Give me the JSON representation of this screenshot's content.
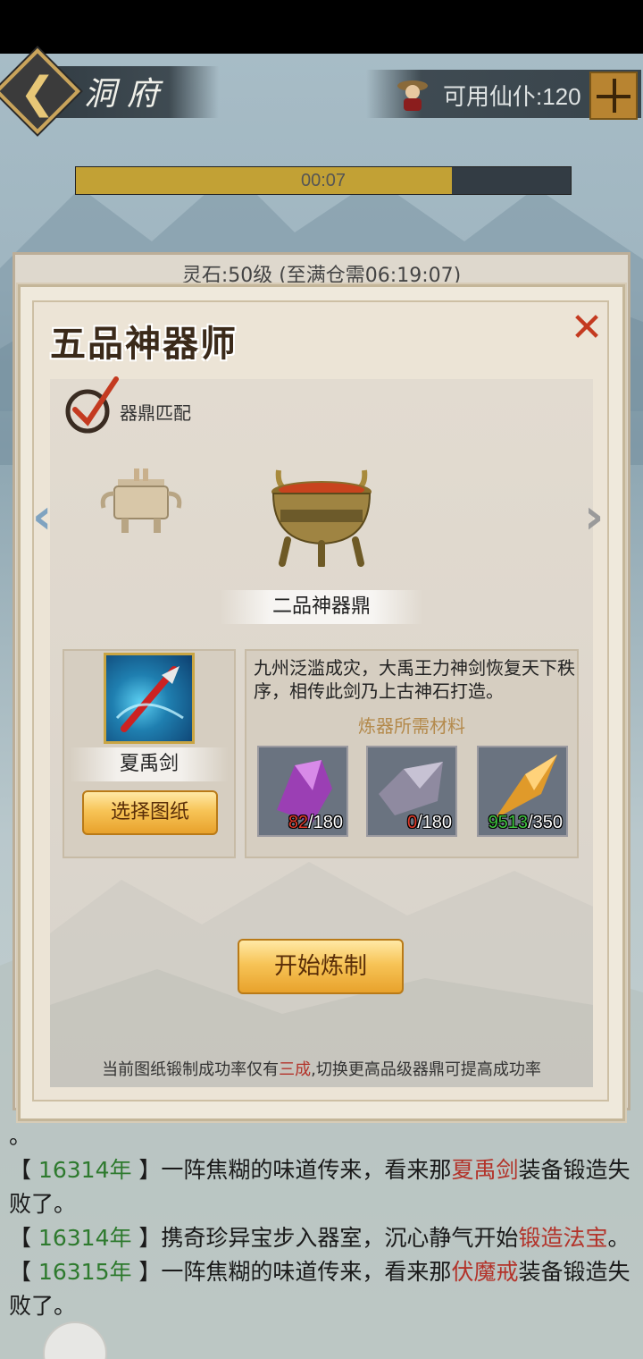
{
  "header": {
    "title": "洞府",
    "servant_label": "可用仙仆:120",
    "plus_label": "+"
  },
  "progress": {
    "time": "00:07",
    "fill_ratio": 0.76
  },
  "back_panel": {
    "title": "灵石:50级 (至满仓需06:19:07)"
  },
  "dialog": {
    "title": "五品神器师",
    "close_icon": "close-icon",
    "match_label": "器鼎匹配",
    "cauldron_name": "二品神器鼎",
    "blueprint": {
      "name": "夏禹剑",
      "select_button": "选择图纸"
    },
    "description": "九州泛滥成灾，大禹王力神剑恢复天下秩序，相传此剑乃上古神石打造。",
    "materials_title": "炼器所需材料",
    "materials": [
      {
        "have": "82",
        "need": "/180",
        "have_color": "#e03a2a",
        "name": "purple-crystal"
      },
      {
        "have": "0",
        "need": "/180",
        "have_color": "#e03a2a",
        "name": "grey-ore"
      },
      {
        "have": "9513",
        "need": "/350",
        "have_color": "#3fc43f",
        "name": "amber-shard"
      }
    ],
    "start_button": "开始炼制",
    "hint_prefix": "当前图纸锻制成功率仅有",
    "hint_rate": "三成",
    "hint_suffix": ",切换更高品级器鼎可提高成功率"
  },
  "log": {
    "lines": [
      {
        "prefix": "。",
        "year": "",
        "mid": "",
        "item": "",
        "suffix": ""
      },
      {
        "prefix": "【 ",
        "year": "16314年",
        "mid": " 】一阵焦糊的味道传来，看来那",
        "item": "夏禹剑",
        "suffix": "装备锻造失败了。"
      },
      {
        "prefix": "【 ",
        "year": "16314年",
        "mid": " 】携奇珍异宝步入器室，沉心静气开始",
        "item": "锻造法宝",
        "suffix": "。"
      },
      {
        "prefix": "【 ",
        "year": "16315年",
        "mid": " 】一阵焦糊的味道传来，看来那",
        "item": "伏魔戒",
        "suffix": "装备锻造失败了。"
      }
    ]
  },
  "colors": {
    "progress_fill": "#c2a135",
    "accent_gold": "#f7c457",
    "year_green": "#2e7a2e",
    "item_red": "#b3332a"
  }
}
